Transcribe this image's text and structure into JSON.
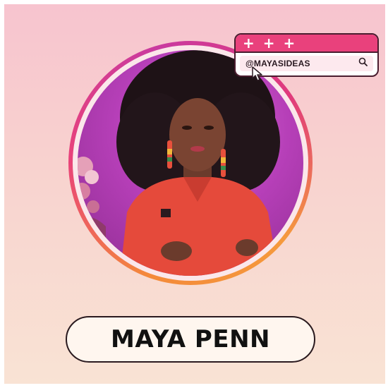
{
  "search_card": {
    "plus_marks": [
      "+",
      "+",
      "+"
    ],
    "handle": "@MAYASIDEAS",
    "search_icon": "magnifier-icon",
    "cursor_icon": "arrow-cursor-icon"
  },
  "name_tag": {
    "name": "MAYA PENN"
  },
  "colors": {
    "background_top": "#f7c4cf",
    "background_bottom": "#f9e3d4",
    "accent_pink": "#e9417c",
    "ring_orange": "#f48a3a",
    "photo_backdrop": "#b63fb8",
    "outline_dark": "#4a1d2f"
  }
}
